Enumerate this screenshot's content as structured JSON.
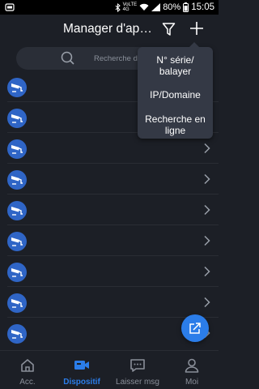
{
  "status_bar": {
    "network_line1": "VoLTE",
    "network_line2": "4G",
    "battery": "80%",
    "time": "15:05"
  },
  "header": {
    "title": "Manager d'appareils"
  },
  "search": {
    "placeholder": "Recherche de dispositif"
  },
  "add_menu": {
    "items": [
      {
        "label_line1": "N° série/",
        "label_line2": "balayer"
      },
      {
        "label_line1": "IP/Domaine",
        "label_line2": ""
      },
      {
        "label_line1": "Recherche en",
        "label_line2": "ligne"
      }
    ]
  },
  "devices": [
    {
      "name": ""
    },
    {
      "name": ""
    },
    {
      "name": ""
    },
    {
      "name": ""
    },
    {
      "name": ""
    },
    {
      "name": ""
    },
    {
      "name": ""
    },
    {
      "name": ""
    },
    {
      "name": ""
    }
  ],
  "nav": {
    "tabs": [
      {
        "label": "Acc.",
        "icon": "home-icon",
        "active": false
      },
      {
        "label": "Dispositif",
        "icon": "camera-icon",
        "active": true
      },
      {
        "label": "Laisser msg",
        "icon": "message-icon",
        "active": false
      },
      {
        "label": "Moi",
        "icon": "person-icon",
        "active": false
      }
    ]
  },
  "colors": {
    "accent": "#2b7de9",
    "background": "#1c1f26",
    "menu": "#343945",
    "device_icon": "#2f65c6"
  }
}
